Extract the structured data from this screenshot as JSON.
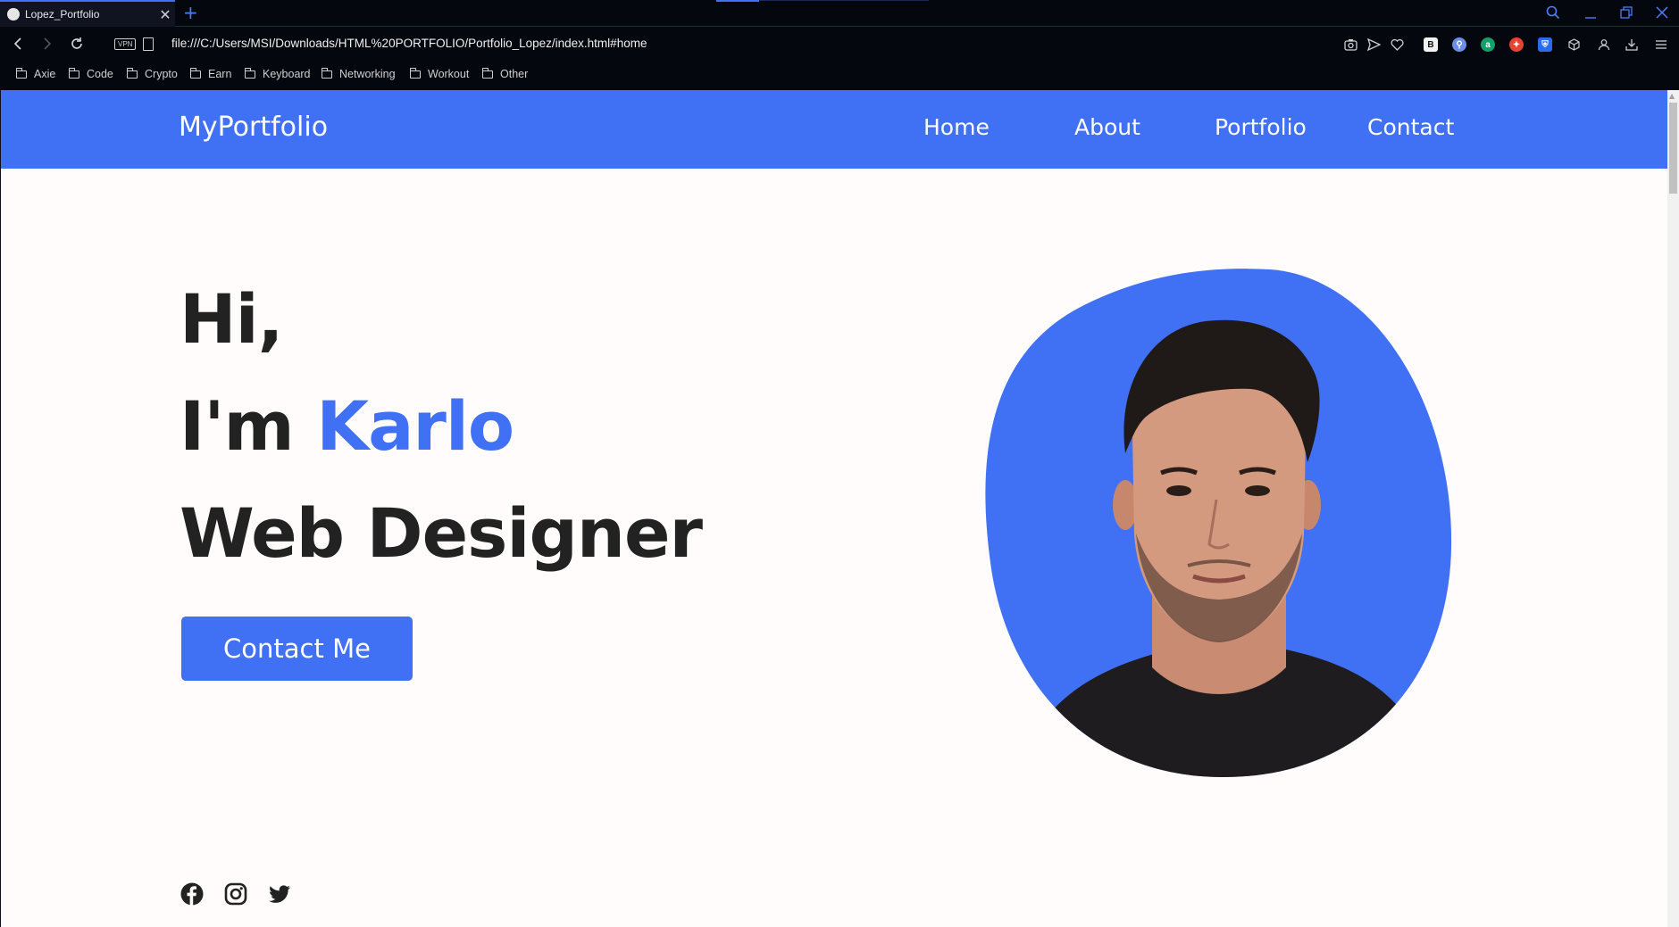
{
  "browser": {
    "tab_title": "Lopez_Portfolio",
    "tab_close": "✕",
    "new_tab": "+",
    "url": "file:///C:/Users/MSI/Downloads/HTML%20PORTFOLIO/Portfolio_Lopez/index.html#home",
    "vpn_label": "VPN",
    "bookmarks": [
      "Axie",
      "Code",
      "Crypto",
      "Earn",
      "Keyboard",
      "Networking",
      "Workout",
      "Other"
    ],
    "extension_icons": [
      "camera-icon",
      "send-icon",
      "heart-icon",
      "b-extension-icon",
      "search-extension-icon",
      "a-extension-icon",
      "flame-extension-icon",
      "shield-extension-icon",
      "cube-icon",
      "profile-icon",
      "download-icon",
      "menu-icon"
    ],
    "extension_letters": {
      "b": "B",
      "a": "a"
    }
  },
  "site": {
    "logo": "MyPortfolio",
    "nav": [
      "Home",
      "About",
      "Portfolio",
      "Contact"
    ],
    "hero": {
      "line1": "Hi,",
      "line2_prefix": "I'm ",
      "line2_name": "Karlo",
      "line3": "Web Designer",
      "cta": "Contact Me"
    },
    "social_icons": [
      "facebook-icon",
      "instagram-icon",
      "twitter-icon"
    ],
    "colors": {
      "accent": "#4070f4",
      "text": "#222222",
      "background": "#fffcfb"
    }
  }
}
